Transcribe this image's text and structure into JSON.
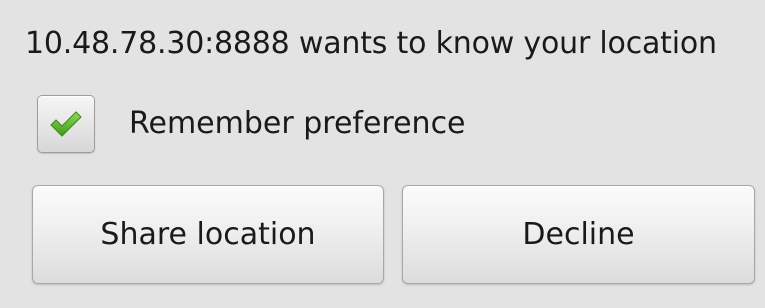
{
  "dialog": {
    "prompt": "10.48.78.30:8888 wants to know your location",
    "remember": {
      "label": "Remember preference",
      "checked": true,
      "icon": "check-icon",
      "check_color": "#5cb82e"
    },
    "buttons": {
      "share_label": "Share location",
      "decline_label": "Decline"
    }
  }
}
